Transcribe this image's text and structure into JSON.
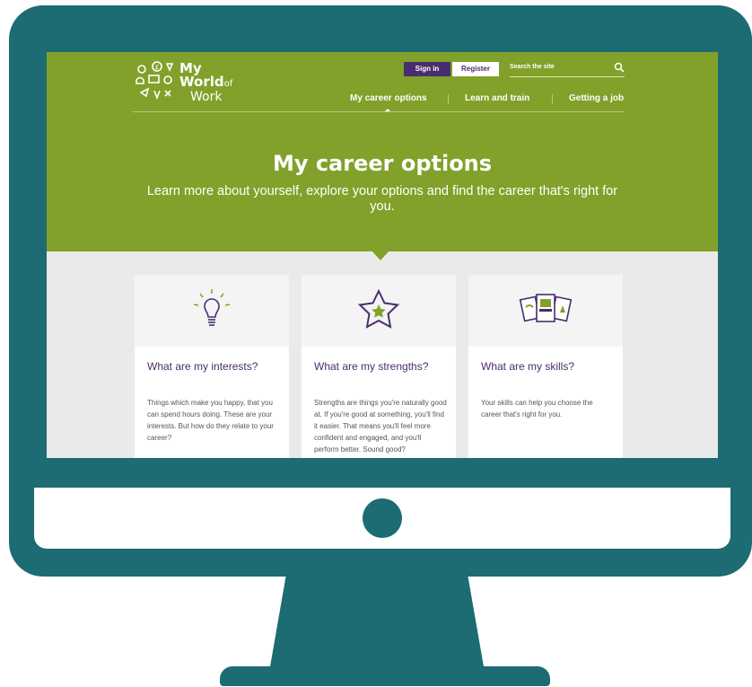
{
  "site": {
    "logo_line1": "My",
    "logo_line2": "World",
    "logo_of": "of",
    "logo_line3": "Work"
  },
  "header": {
    "signin_label": "Sign in",
    "register_label": "Register",
    "search_placeholder": "Search the site"
  },
  "nav": {
    "items": [
      {
        "label": "My career options"
      },
      {
        "label": "Learn and train"
      },
      {
        "label": "Getting a job"
      }
    ]
  },
  "hero": {
    "title": "My career options",
    "subtitle": "Learn more about yourself, explore your options and find the career that's right for you."
  },
  "cards": [
    {
      "icon": "lightbulb-icon",
      "title": "What are my interests?",
      "text": "Things which make you happy, that you can spend hours doing. These are your interests. But how do they relate to your career?"
    },
    {
      "icon": "star-icon",
      "title": "What are my strengths?",
      "text": "Strengths are things you're naturally good at. If you're good at something, you'll find it easier. That means you'll feel more confident and engaged, and you'll perform better. Sound good?"
    },
    {
      "icon": "cards-icon",
      "title": "What are my skills?",
      "text": "Your skills can help you choose the career that's right for you."
    }
  ],
  "colors": {
    "monitor": "#1d6b73",
    "brand_green": "#81a12a",
    "brand_purple": "#4a2d6e",
    "page_bg": "#eaeaea"
  }
}
